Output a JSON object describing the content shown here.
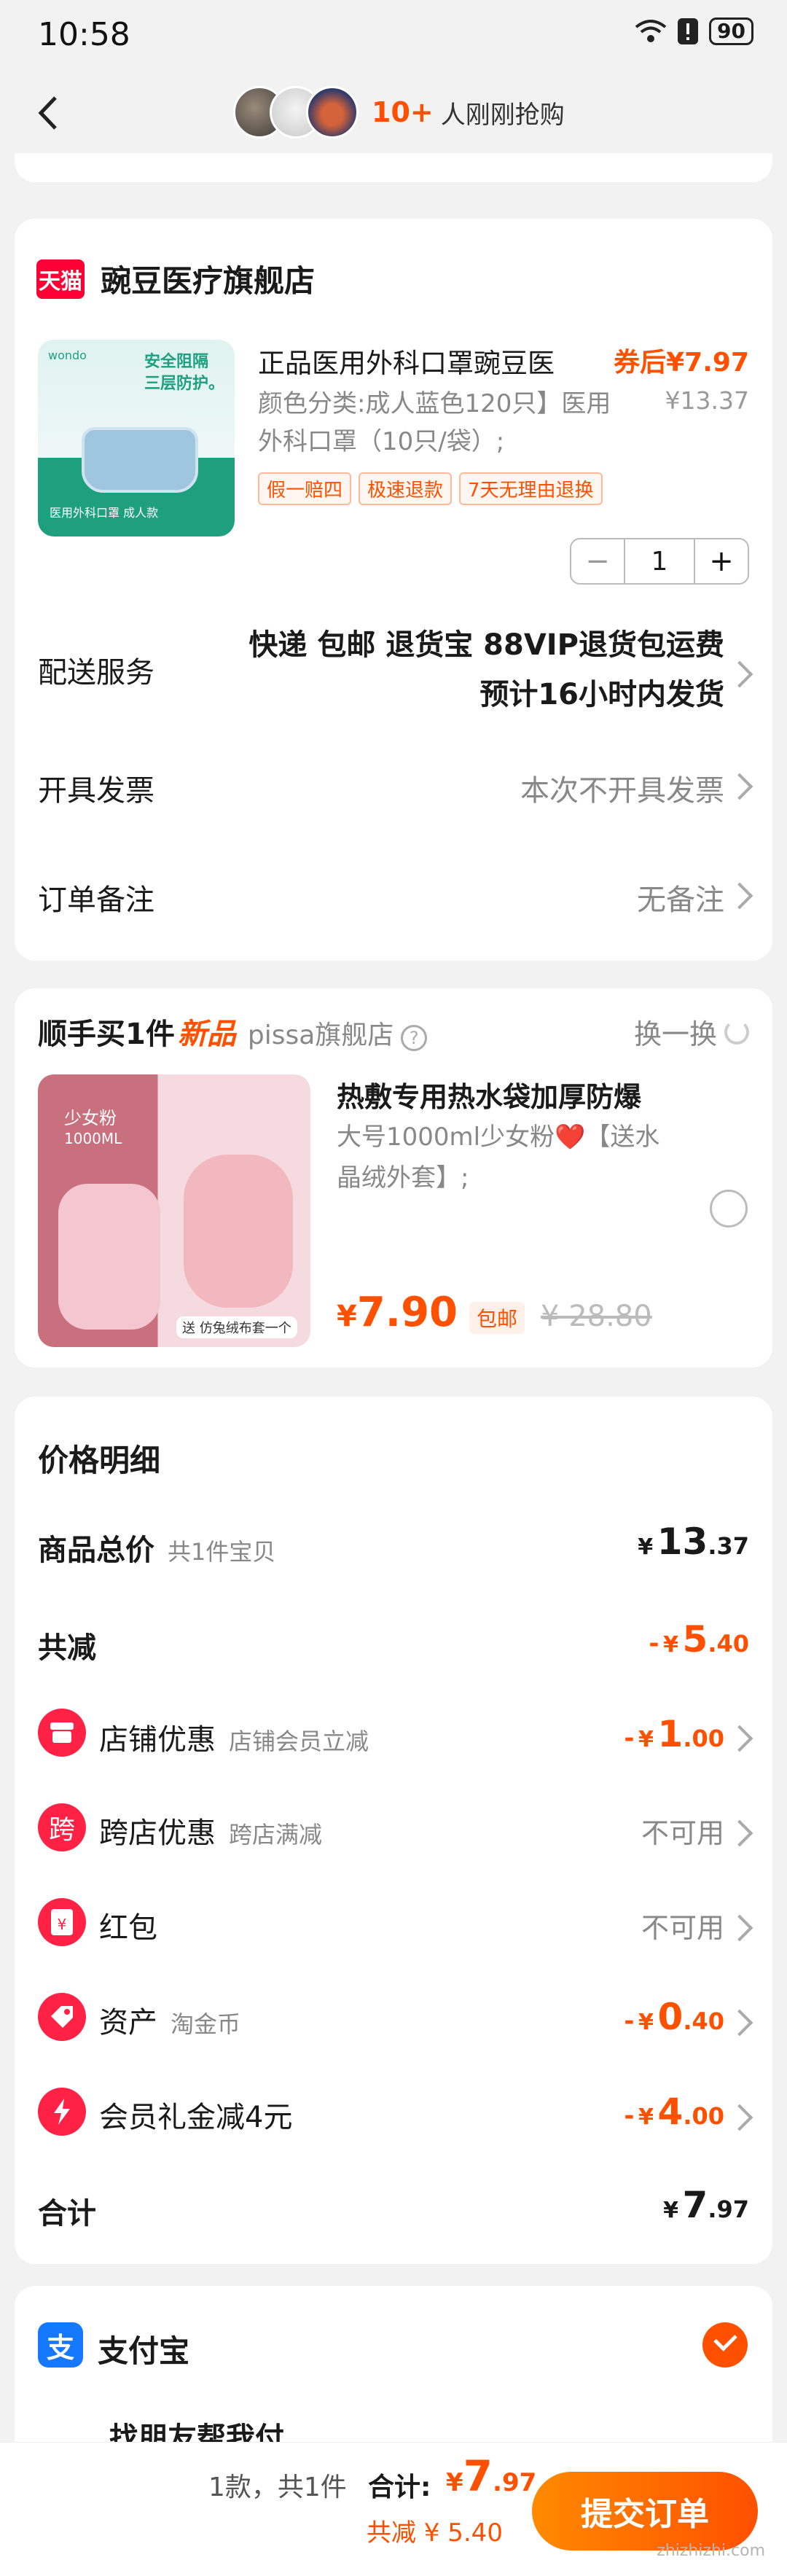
{
  "status": {
    "time": "10:58",
    "battery": "90"
  },
  "nav": {
    "buyers_count": "10+",
    "buyers_text": "人刚刚抢购"
  },
  "shop": {
    "badge": "天猫",
    "name": "豌豆医疗旗舰店",
    "product": {
      "image_brand": "wondo",
      "image_tag": "安全阻隔 三层防护。",
      "image_caption": "医用外科口罩 成人款",
      "title": "正品医用外科口罩豌豆医",
      "sku": "颜色分类:成人蓝色120只】医用外科口罩（10只/袋）;",
      "price": "券后¥7.97",
      "orig_price": "¥13.37",
      "tags": [
        "假一赔四",
        "极速退款",
        "7天无理由退换"
      ],
      "qty": "1"
    },
    "delivery_label": "配送服务",
    "delivery_line1": "快递 包邮 退货宝 88VIP退货包运费",
    "delivery_line2": "预计16小时内发货",
    "invoice_label": "开具发票",
    "invoice_value": "本次不开具发票",
    "note_label": "订单备注",
    "note_value": "无备注"
  },
  "addon": {
    "title": "顺手买1件",
    "new_tag": "新品",
    "shop": "pissa旗舰店",
    "help": "?",
    "swap": "换一换",
    "image_label1": "少女粉",
    "image_label2": "1000ML",
    "image_gift": "送 仿兔绒布套一个",
    "name": "热敷专用热水袋加厚防爆",
    "desc": "大号1000ml少女粉❤️【送水晶绒外套】;",
    "price_yen": "¥",
    "price": "7.90",
    "shipping": "包邮",
    "orig_price": "¥ 28.80"
  },
  "price_detail": {
    "title": "价格明细",
    "goods_label": "商品总价",
    "goods_sub": "共1件宝贝",
    "goods_yen": "¥",
    "goods_int": "13",
    "goods_dec": ".37",
    "reduce_label": "共减",
    "reduce_sign": "-",
    "reduce_yen": "¥",
    "reduce_int": "5",
    "reduce_dec": ".40",
    "shop_promo_label": "店铺优惠",
    "shop_promo_sub": "店铺会员立减",
    "shop_promo_int": "1",
    "shop_promo_dec": ".00",
    "cross_label": "跨店优惠",
    "cross_icon": "跨",
    "cross_sub": "跨店满减",
    "cross_value": "不可用",
    "redpack_label": "红包",
    "redpack_icon": "¥",
    "redpack_value": "不可用",
    "asset_label": "资产",
    "asset_sub": "淘金币",
    "asset_int": "0",
    "asset_dec": ".40",
    "member_label": "会员礼金减4元",
    "member_int": "4",
    "member_dec": ".00",
    "total_label": "合计",
    "total_yen": "¥",
    "total_int": "7",
    "total_dec": ".97"
  },
  "payment": {
    "alipay_icon": "支",
    "alipay_name": "支付宝",
    "friend_pay": "找朋友帮我付"
  },
  "bottom": {
    "count": "1款，共1件",
    "total_label": "合计:",
    "total_yen": "¥",
    "total_int": "7",
    "total_dec": ".97",
    "saved": "共减 ¥ 5.40",
    "submit": "提交订单",
    "watermark": "zhizhizhi.com"
  },
  "colors": {
    "accent": "#ff5000",
    "tmall": "#ff0036",
    "alipay": "#1677ff"
  }
}
